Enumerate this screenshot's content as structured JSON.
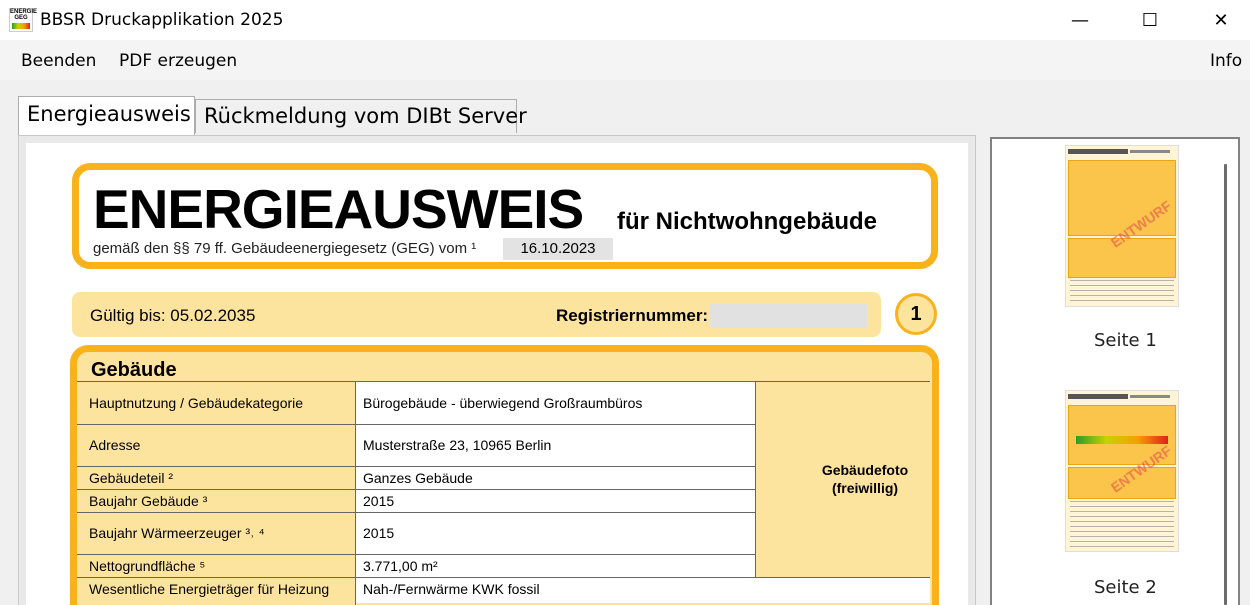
{
  "window": {
    "title": "BBSR Druckapplikation 2025",
    "icon_text": "ENERGIE GEG",
    "minimize": "—",
    "maximize": "☐",
    "close": "✕"
  },
  "menu": {
    "items": [
      "Beenden",
      "PDF erzeugen"
    ],
    "info": "Info"
  },
  "tabs": [
    {
      "label": "Energieausweis",
      "active": true
    },
    {
      "label": "Rückmeldung vom DIBt Server",
      "active": false
    }
  ],
  "document": {
    "title": "ENERGIEAUSWEIS",
    "subtitle": "für Nichtwohngebäude",
    "legal": "gemäß den §§ 79 ff. Gebäudeenergiegesetz (GEG) vom ¹",
    "date": "16.10.2023",
    "valid_until": "Gültig bis: 05.02.2035",
    "registration_label": "Registriernummer:",
    "registration_value": "",
    "page_number": "1",
    "building_section": "Gebäude",
    "rows": [
      {
        "label": "Hauptnutzung / Gebäudekategorie",
        "value": "Bürogebäude - überwiegend Großraumbüros"
      },
      {
        "label": "Adresse",
        "value": "Musterstraße 23, 10965 Berlin"
      },
      {
        "label": "Gebäudeteil ²",
        "value": "Ganzes Gebäude"
      },
      {
        "label": "Baujahr Gebäude ³",
        "value": "2015"
      },
      {
        "label": "Baujahr Wärmeerzeuger ³˒ ⁴",
        "value": "2015"
      },
      {
        "label": "Nettogrundfläche ⁵",
        "value": "3.771,00 m²"
      },
      {
        "label": "Wesentliche Energieträger für Heizung",
        "value": "Nah-/Fernwärme KWK fossil"
      }
    ],
    "photo_line1": "Gebäudefoto",
    "photo_line2": "(freiwillig)"
  },
  "thumbnails": [
    {
      "label": "Seite 1",
      "stamp": "ENTWURF"
    },
    {
      "label": "Seite 2",
      "stamp": "ENTWURF"
    }
  ]
}
